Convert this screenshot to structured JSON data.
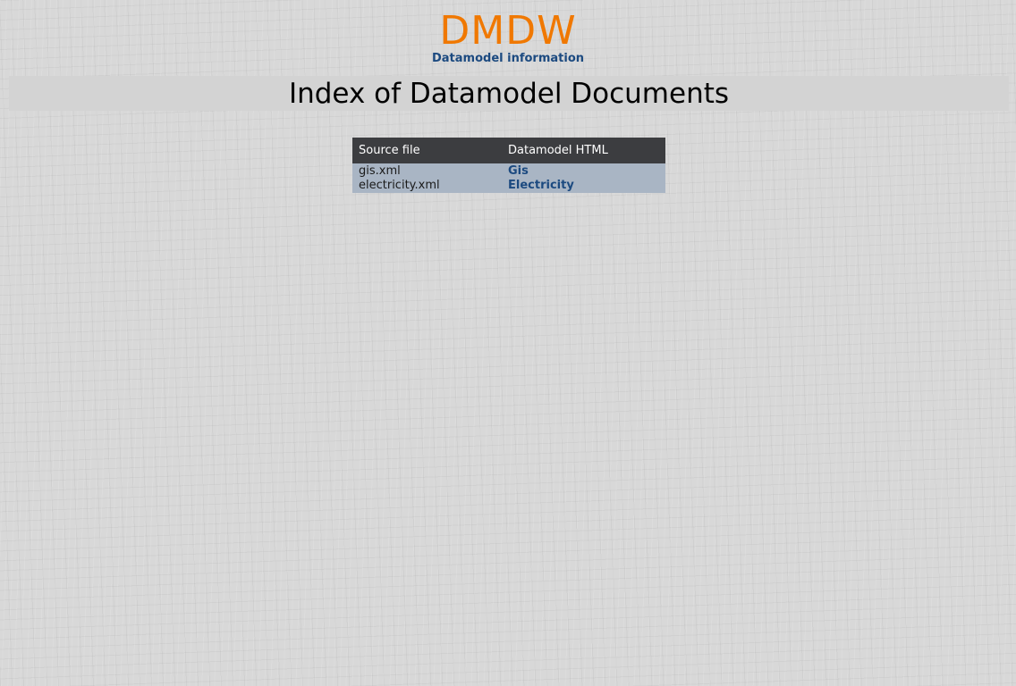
{
  "header": {
    "logo_text": "DMDW",
    "subtitle": "Datamodel information",
    "logo_color": "#f07800",
    "subtitle_color": "#1c4a80"
  },
  "page": {
    "title": "Index of Datamodel Documents"
  },
  "table": {
    "columns": [
      "Source file",
      "Datamodel HTML"
    ],
    "rows": [
      {
        "source_file": "gis.xml",
        "datamodel_html": "Gis"
      },
      {
        "source_file": "electricity.xml",
        "datamodel_html": "Electricity"
      }
    ],
    "header_bg": "#3c3d40",
    "row_bg": "#a9b5c4",
    "link_color": "#1c4a80"
  }
}
